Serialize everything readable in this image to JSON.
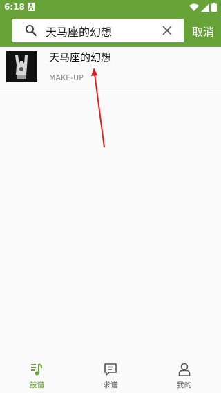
{
  "status_bar": {
    "time": "6:18"
  },
  "search": {
    "query": "天马座的幻想"
  },
  "header": {
    "cancel_label": "取消"
  },
  "results": [
    {
      "title": "天马座的幻想",
      "artist": "MAKE-UP"
    }
  ],
  "bottom_nav": {
    "items": [
      {
        "label": "鼓谱",
        "icon": "drum-score-icon",
        "active": true
      },
      {
        "label": "求谱",
        "icon": "message-icon",
        "active": false
      },
      {
        "label": "我的",
        "icon": "user-icon",
        "active": false
      }
    ]
  },
  "colors": {
    "accent": "#68a33a",
    "annotation_arrow": "#e01f1f"
  }
}
